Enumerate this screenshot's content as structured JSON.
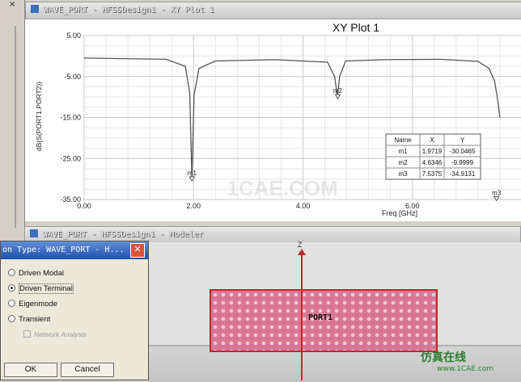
{
  "plot_window": {
    "title": "WAVE_PORT - HFSSDesign1 - XY Plot 1"
  },
  "modeler_window": {
    "title": "WAVE_PORT - HFSSDesign1 - Modeler"
  },
  "chart_data": {
    "type": "line",
    "title": "XY Plot 1",
    "xlabel": "Freq [GHz]",
    "ylabel": "dB(S(PORT1,PORT2))",
    "xlim": [
      0,
      8
    ],
    "ylim": [
      -35,
      5
    ],
    "x_ticks": [
      "0.00",
      "2.00",
      "4.00",
      "6.00"
    ],
    "y_ticks": [
      "5.00",
      "-5.00",
      "-15.00",
      "-25.00",
      "-35.00"
    ],
    "grid": true,
    "series": [
      {
        "x": [
          0.0,
          1.5,
          1.85,
          1.93,
          1.97,
          2.01,
          2.1,
          2.4,
          3.5,
          4.45,
          4.58,
          4.63,
          4.67,
          4.78,
          5.5,
          6.5,
          7.2,
          7.4,
          7.5,
          7.55,
          7.6
        ],
        "y": [
          -0.5,
          -0.8,
          -2.5,
          -9.0,
          -30.0,
          -9.5,
          -3.0,
          -1.2,
          -0.9,
          -1.5,
          -5.0,
          -10.0,
          -5.0,
          -1.2,
          -0.9,
          -0.8,
          -1.3,
          -3.0,
          -6.0,
          -10.0,
          -15.0
        ]
      }
    ],
    "markers": [
      {
        "name": "m1",
        "x": 1.9719,
        "y": -30.0465
      },
      {
        "name": "m2",
        "x": 4.6346,
        "y": -9.9999
      },
      {
        "name": "m3",
        "x": 7.5375,
        "y": -34.9131
      }
    ],
    "marker_table": {
      "headers": [
        "Name",
        "X",
        "Y"
      ],
      "rows": [
        [
          "m1",
          "1.9719",
          "-30.0465"
        ],
        [
          "m2",
          "4.6346",
          "-9.9999"
        ],
        [
          "m3",
          "7.5375",
          "-34.9131"
        ]
      ]
    }
  },
  "dialog": {
    "title": "on Type: WAVE_PORT - H...",
    "close_glyph": "✕",
    "options": [
      "Driven Modal",
      "Driven Terminal",
      "Eigenmode",
      "Transient"
    ],
    "selected_index": 1,
    "checkbox_label": "Network Analysis",
    "checkbox_checked": false,
    "ok_label": "OK",
    "cancel_label": "Cancel"
  },
  "modeler": {
    "axis_label": "Z",
    "port_label": "PORT1"
  },
  "watermark": {
    "center": "1CAE.COM",
    "corner": "仿真在线",
    "corner_url": "www.1CAE.com"
  },
  "colors": {
    "curve": "#555555",
    "port_fill": "#d97894",
    "port_border": "#c0292b",
    "axis": "#c62828"
  }
}
